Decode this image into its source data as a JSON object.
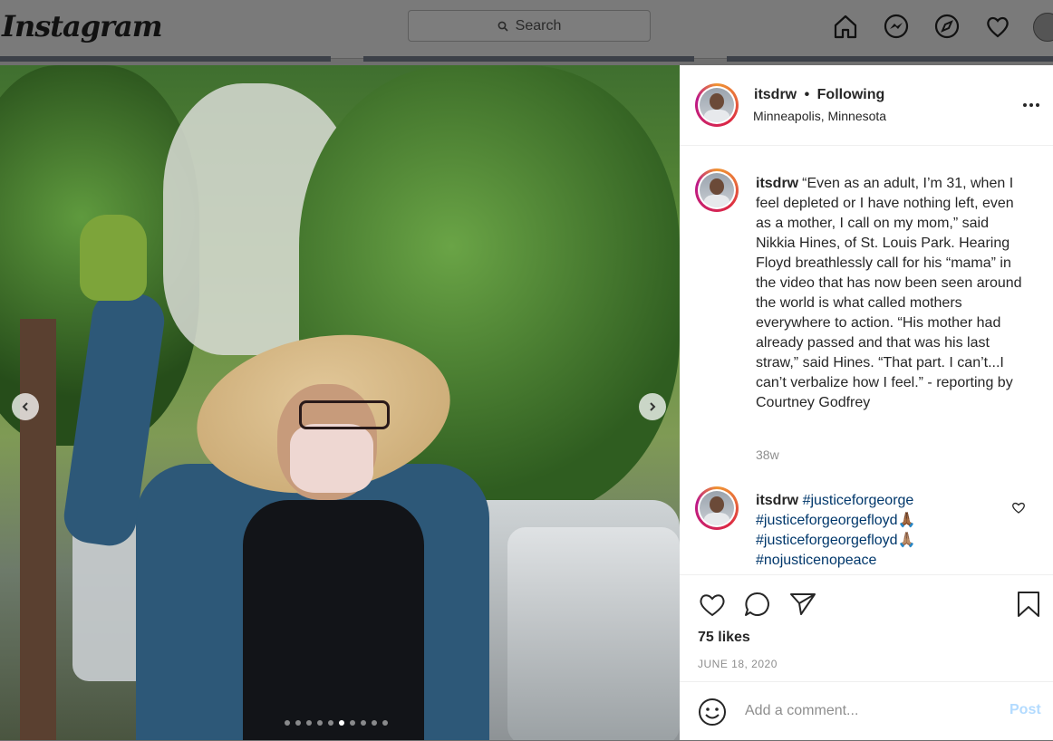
{
  "topbar": {
    "logo": "Instagram",
    "search_placeholder": "Search"
  },
  "post": {
    "author": {
      "username": "itsdrw",
      "follow_status": "Following",
      "separator": "•",
      "location": "Minneapolis, Minnesota"
    },
    "caption": {
      "username": "itsdrw",
      "text": "“Even as an adult, I’m 31, when I feel depleted or I have nothing left, even as a mother, I call on my mom,” said Nikkia Hines, of St. Louis Park. Hearing Floyd breathlessly call for his “mama” in the video that has now been seen around the world is what called mothers everywhere to action. “His mother had already passed and that was his last straw,” said Hines. “That part. I can’t...I can’t verbalize how I feel.” - reporting by Courtney Godfrey",
      "age": "38w"
    },
    "comment": {
      "username": "itsdrw",
      "tags": [
        "#justiceforgeorge",
        "#justiceforgeorgefloyd🙏🏾",
        "#justiceforgeorgefloyd🙏🏽",
        "#nojusticenopeace"
      ]
    },
    "likes": "75 likes",
    "date": "JUNE 18, 2020",
    "carousel": {
      "total": 10,
      "active_index": 5
    },
    "add_comment_placeholder": "Add a comment...",
    "post_label": "Post"
  },
  "colors": {
    "link": "#00376b",
    "muted": "#8e8e8e",
    "post_disabled": "#b3dbff"
  }
}
